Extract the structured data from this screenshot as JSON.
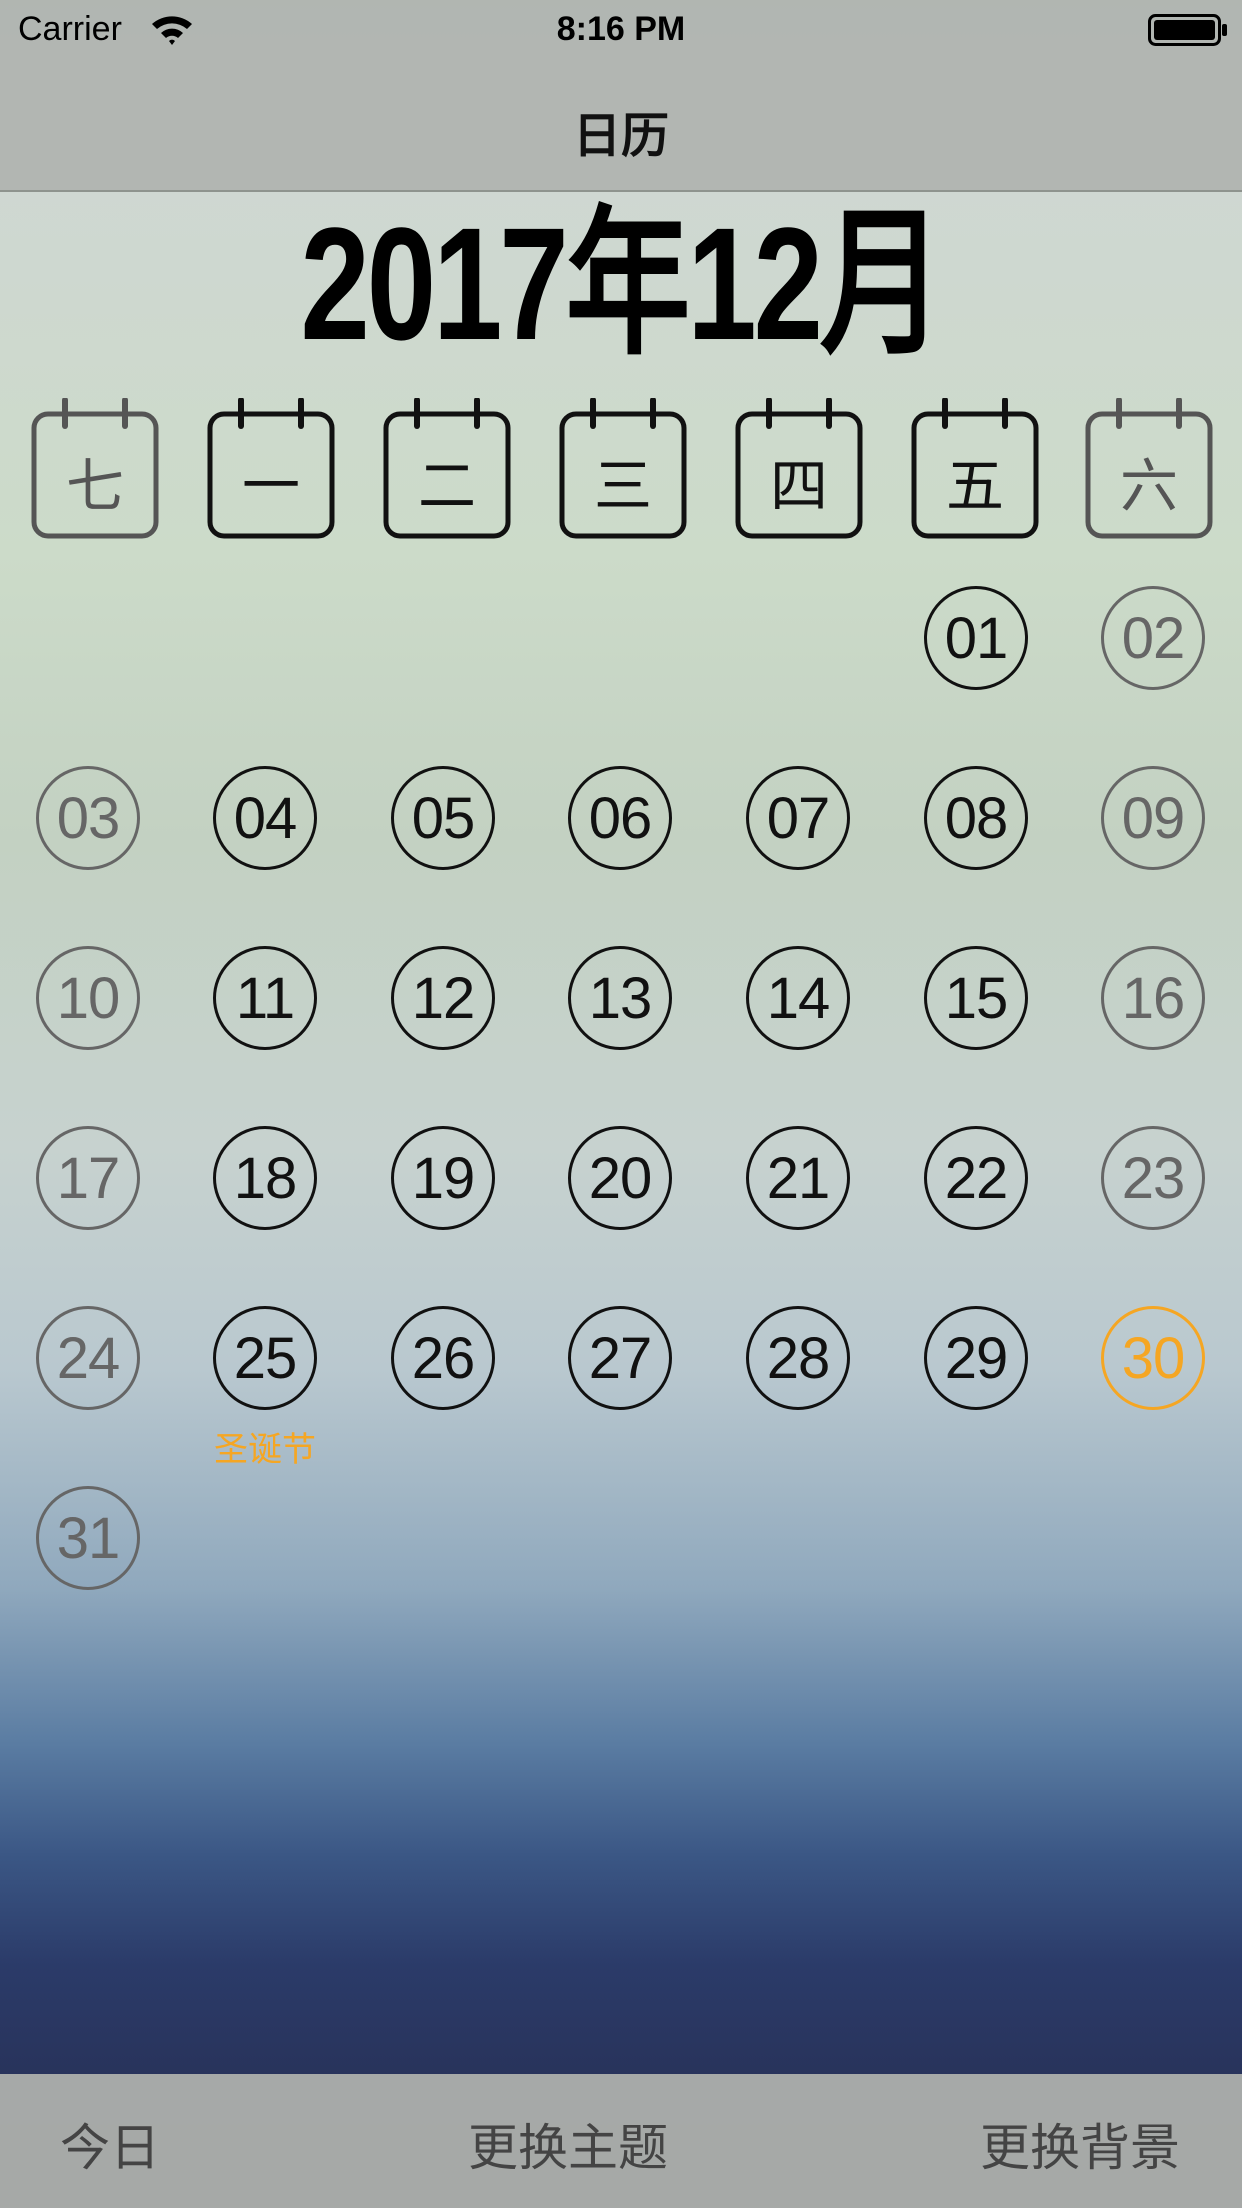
{
  "status_bar": {
    "carrier": "Carrier",
    "time": "8:16 PM"
  },
  "nav": {
    "title": "日历"
  },
  "calendar": {
    "month_title": "2017年12月",
    "weekdays": [
      "七",
      "一",
      "二",
      "三",
      "四",
      "五",
      "六"
    ],
    "today": "30",
    "weeks": [
      [
        "",
        "",
        "",
        "",
        "",
        "01",
        "02"
      ],
      [
        "03",
        "04",
        "05",
        "06",
        "07",
        "08",
        "09"
      ],
      [
        "10",
        "11",
        "12",
        "13",
        "14",
        "15",
        "16"
      ],
      [
        "17",
        "18",
        "19",
        "20",
        "21",
        "22",
        "23"
      ],
      [
        "24",
        "25",
        "26",
        "27",
        "28",
        "29",
        "30"
      ],
      [
        "31",
        "",
        "",
        "",
        "",
        "",
        ""
      ]
    ],
    "holidays": [
      {
        "day": "25",
        "label": "圣诞节"
      }
    ]
  },
  "toolbar": {
    "today_label": "今日",
    "theme_label": "更换主题",
    "background_label": "更换背景"
  },
  "colors": {
    "accent": "#f5a623",
    "weekend": "#666666",
    "weekday": "#111111"
  }
}
